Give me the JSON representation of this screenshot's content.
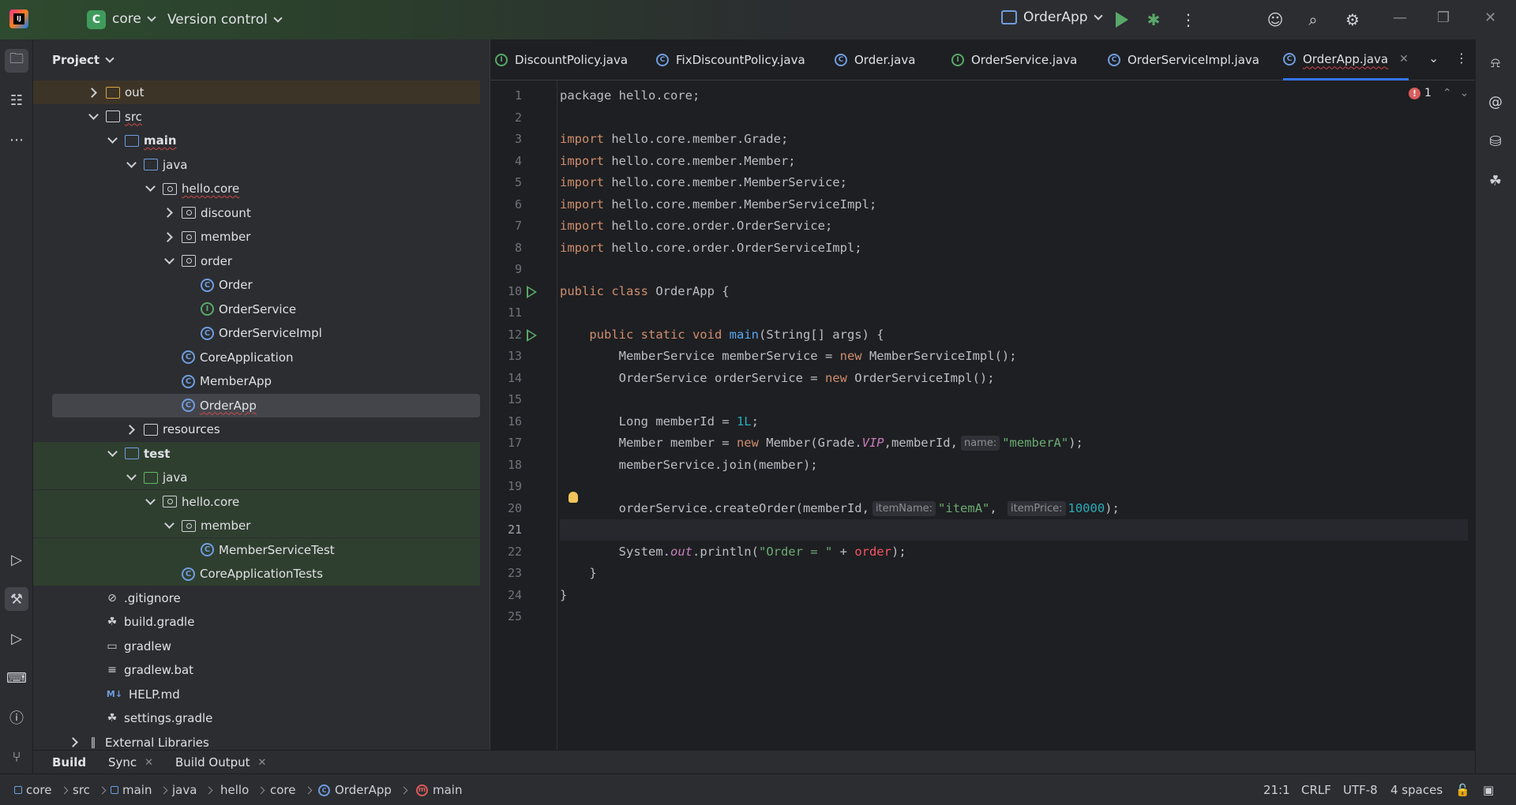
{
  "titlebar": {
    "project_badge": "C",
    "project_name": "core",
    "version_control": "Version control",
    "run_config": "OrderApp"
  },
  "project_panel": {
    "title": "Project",
    "tree": [
      {
        "label": "out",
        "depth": 1,
        "state": "closed",
        "icon": "folder-orange"
      },
      {
        "label": "src",
        "depth": 1,
        "state": "open",
        "icon": "folder"
      },
      {
        "label": "main",
        "depth": 2,
        "state": "open",
        "icon": "folder-module",
        "bold": true
      },
      {
        "label": "java",
        "depth": 3,
        "state": "open",
        "icon": "folder-blue"
      },
      {
        "label": "hello.core",
        "depth": 4,
        "state": "open",
        "icon": "package"
      },
      {
        "label": "discount",
        "depth": 5,
        "state": "closed",
        "icon": "package"
      },
      {
        "label": "member",
        "depth": 5,
        "state": "closed",
        "icon": "package"
      },
      {
        "label": "order",
        "depth": 5,
        "state": "open",
        "icon": "package"
      },
      {
        "label": "Order",
        "depth": 6,
        "state": "none",
        "icon": "class"
      },
      {
        "label": "OrderService",
        "depth": 6,
        "state": "none",
        "icon": "interface"
      },
      {
        "label": "OrderServiceImpl",
        "depth": 6,
        "state": "none",
        "icon": "class"
      },
      {
        "label": "CoreApplication",
        "depth": 5,
        "state": "none",
        "icon": "class-run"
      },
      {
        "label": "MemberApp",
        "depth": 5,
        "state": "none",
        "icon": "class-run"
      },
      {
        "label": "OrderApp",
        "depth": 5,
        "state": "none",
        "icon": "class-run",
        "selected": true
      },
      {
        "label": "resources",
        "depth": 3,
        "state": "closed",
        "icon": "folder-resources"
      },
      {
        "label": "test",
        "depth": 2,
        "state": "open",
        "icon": "folder-module",
        "bold": true
      },
      {
        "label": "java",
        "depth": 3,
        "state": "open",
        "icon": "folder-green"
      },
      {
        "label": "hello.core",
        "depth": 4,
        "state": "open",
        "icon": "package"
      },
      {
        "label": "member",
        "depth": 5,
        "state": "open",
        "icon": "package"
      },
      {
        "label": "MemberServiceTest",
        "depth": 6,
        "state": "none",
        "icon": "class-run"
      },
      {
        "label": "CoreApplicationTests",
        "depth": 5,
        "state": "none",
        "icon": "class-run"
      },
      {
        "label": ".gitignore",
        "depth": 1,
        "state": "none",
        "icon": "ignore-file"
      },
      {
        "label": "build.gradle",
        "depth": 1,
        "state": "none",
        "icon": "gradle-file"
      },
      {
        "label": "gradlew",
        "depth": 1,
        "state": "none",
        "icon": "shell-file"
      },
      {
        "label": "gradlew.bat",
        "depth": 1,
        "state": "none",
        "icon": "text-file"
      },
      {
        "label": "HELP.md",
        "depth": 1,
        "state": "none",
        "icon": "markdown-file"
      },
      {
        "label": "settings.gradle",
        "depth": 1,
        "state": "none",
        "icon": "gradle-file"
      },
      {
        "label": "External Libraries",
        "depth": 0,
        "state": "closed",
        "icon": "library"
      }
    ]
  },
  "editor": {
    "tabs": [
      {
        "label": "DiscountPolicy.java",
        "icon": "interface"
      },
      {
        "label": "FixDiscountPolicy.java",
        "icon": "class"
      },
      {
        "label": "Order.java",
        "icon": "class"
      },
      {
        "label": "OrderService.java",
        "icon": "interface"
      },
      {
        "label": "OrderServiceImpl.java",
        "icon": "class"
      },
      {
        "label": "OrderApp.java",
        "icon": "class-run",
        "active": true
      }
    ],
    "error_count": "1",
    "current_line": 21,
    "hints": {
      "name": "name:",
      "item_name": "itemName:",
      "item_price": "itemPrice:"
    }
  },
  "bottom_tabs": [
    {
      "label": "Build",
      "active": true
    },
    {
      "label": "Sync",
      "closable": true
    },
    {
      "label": "Build Output",
      "closable": true
    }
  ],
  "statusbar": {
    "breadcrumbs": [
      "core",
      "src",
      "main",
      "java",
      "hello",
      "core",
      "OrderApp",
      "main"
    ],
    "position": "21:1",
    "line_sep": "CRLF",
    "encoding": "UTF-8",
    "indent": "4 spaces"
  },
  "colors": {
    "accent": "#3574f0",
    "error": "#db5c5c",
    "run": "#59a869",
    "keyword": "#cf8e6d"
  }
}
